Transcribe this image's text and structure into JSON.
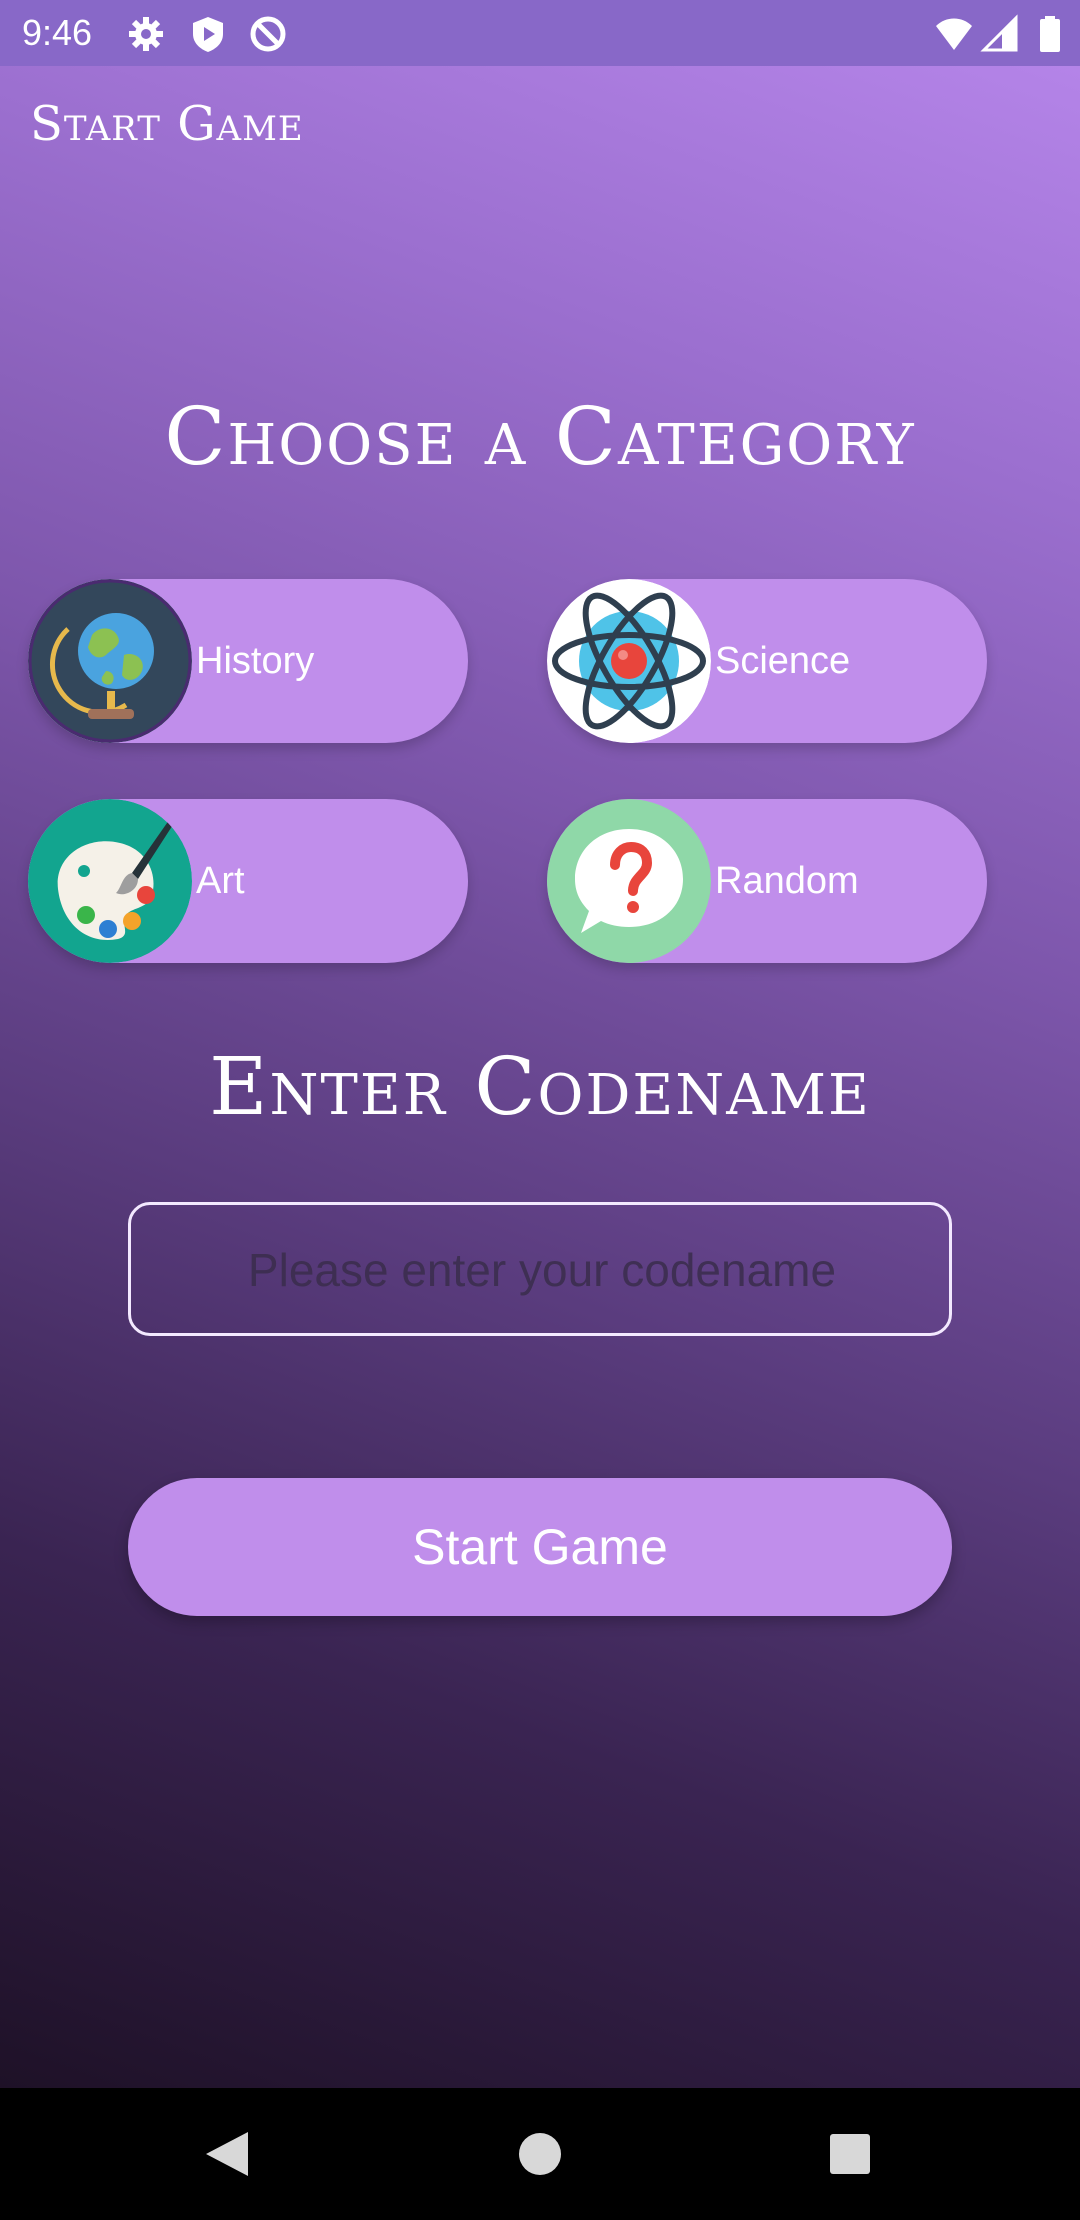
{
  "status_bar": {
    "time": "9:46",
    "icons": [
      "gear-icon",
      "shield-icon",
      "circle-slash-icon",
      "wifi-icon",
      "signal-icon",
      "battery-icon"
    ]
  },
  "app_bar": {
    "title": "Start Game"
  },
  "category_section": {
    "heading": "Choose a Category",
    "categories": [
      {
        "label": "History",
        "icon": "globe-icon"
      },
      {
        "label": "Science",
        "icon": "atom-icon"
      },
      {
        "label": "Art",
        "icon": "palette-icon"
      },
      {
        "label": "Random",
        "icon": "question-bubble-icon"
      }
    ]
  },
  "codename_section": {
    "heading": "Enter Codename",
    "placeholder": "Please enter your codename",
    "value": ""
  },
  "start_button": {
    "label": "Start Game"
  },
  "colors": {
    "status_bar": "#8868c8",
    "button": "#c08eeb",
    "gradient_top": "#b887ec",
    "gradient_bottom": "#1e1127"
  },
  "nav_bar": {
    "icons": [
      "back-icon",
      "home-icon",
      "recents-icon"
    ]
  }
}
